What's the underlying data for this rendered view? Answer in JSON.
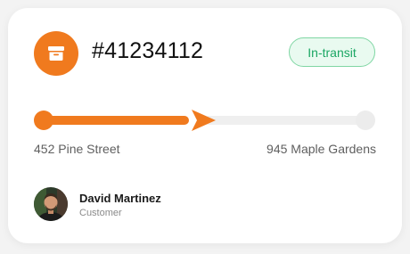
{
  "order": {
    "id": "#41234112",
    "icon": "archive-box-icon",
    "accent_color": "#f07a1e"
  },
  "status": {
    "label": "In-transit",
    "color": "#1aa663",
    "background": "#e9faf0"
  },
  "route": {
    "origin": "452 Pine Street",
    "destination": "945 Maple Gardens",
    "progress": 0.48,
    "track_color": "#efefef"
  },
  "contact": {
    "name": "David Martinez",
    "role": "Customer",
    "avatar_icon": "user-avatar"
  }
}
